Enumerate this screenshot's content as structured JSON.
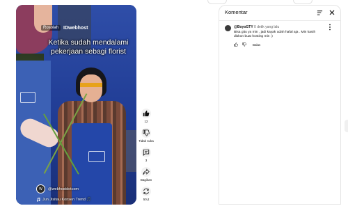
{
  "video": {
    "promo_label": "Rosolah",
    "brand_watermark": "IDwebhost",
    "overlay_title": "Ketika sudah mendalami pekerjaan sebagi florist",
    "channel_name": "@webhostdotcom",
    "channel_avatar_letter": "W",
    "sound_label": "Jun Jisitau Konsen Trend 🎵"
  },
  "actions": {
    "like_count": "12",
    "dislike_label": "Tidak suka",
    "comment_count": "3",
    "share_label": "Bagikan",
    "remix_label": "50 jt"
  },
  "comments_panel": {
    "title": "Komentar",
    "comment": {
      "author": "@BoyoGTY",
      "time": "0 detik yang lalu",
      "text": "Bisa gitu ya min , jadi kayak udah hafal aja . Min kasih diskon buat hosting min :)",
      "reply_label": "Balas"
    }
  },
  "colors": {
    "text_primary": "#0f0f0f",
    "text_secondary": "#606060",
    "action_bg": "#f2f2f2",
    "apron_blue": "#2447a9"
  },
  "icons": [
    "like-icon",
    "dislike-icon",
    "comment-icon",
    "share-icon",
    "remix-icon",
    "sort-icon",
    "close-icon",
    "more-vert-icon",
    "music-icon"
  ]
}
